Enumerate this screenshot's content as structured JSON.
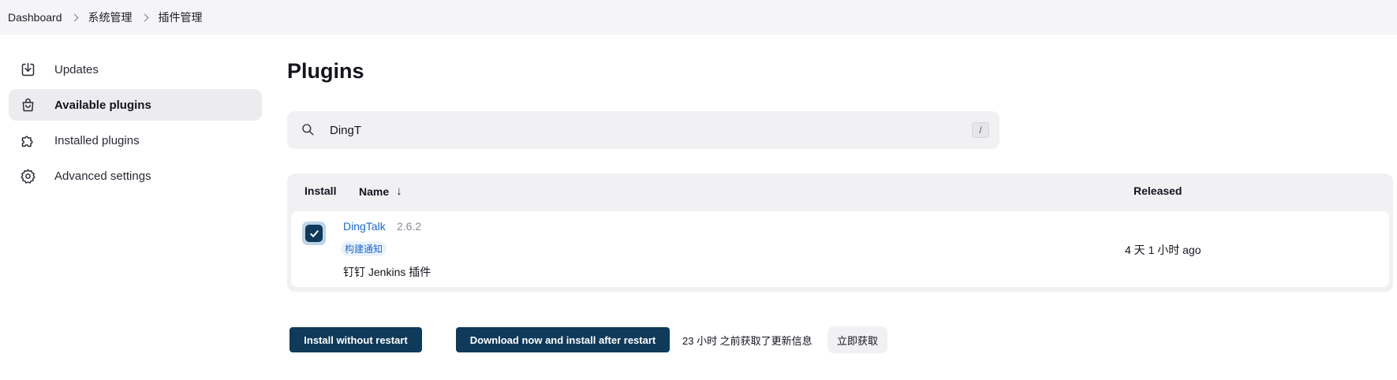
{
  "breadcrumb": [
    {
      "label": "Dashboard"
    },
    {
      "label": "系统管理"
    },
    {
      "label": "插件管理"
    }
  ],
  "sidebar": {
    "items": [
      {
        "label": "Updates",
        "icon": "download-icon",
        "active": false
      },
      {
        "label": "Available plugins",
        "icon": "shopping-bag-icon",
        "active": true
      },
      {
        "label": "Installed plugins",
        "icon": "puzzle-icon",
        "active": false
      },
      {
        "label": "Advanced settings",
        "icon": "gear-icon",
        "active": false
      }
    ]
  },
  "main": {
    "title": "Plugins",
    "search": {
      "value": "DingT",
      "shortcut": "/"
    },
    "table": {
      "headers": {
        "install": "Install",
        "name": "Name",
        "name_sort": "↓",
        "released": "Released"
      },
      "rows": [
        {
          "checked": true,
          "name": "DingTalk",
          "version": "2.6.2",
          "tag": "构建通知",
          "description": "钉钉 Jenkins 插件",
          "released": "4 天 1 小时 ago"
        }
      ]
    },
    "actions": {
      "install_without_restart": "Install without restart",
      "download_and_install": "Download now and install after restart",
      "update_info": "23 小时 之前获取了更新信息",
      "fetch_now": "立即获取"
    }
  },
  "colors": {
    "accent": "#0f3a5a",
    "link": "#1e6bd1",
    "surface": "#f1f1f4"
  }
}
